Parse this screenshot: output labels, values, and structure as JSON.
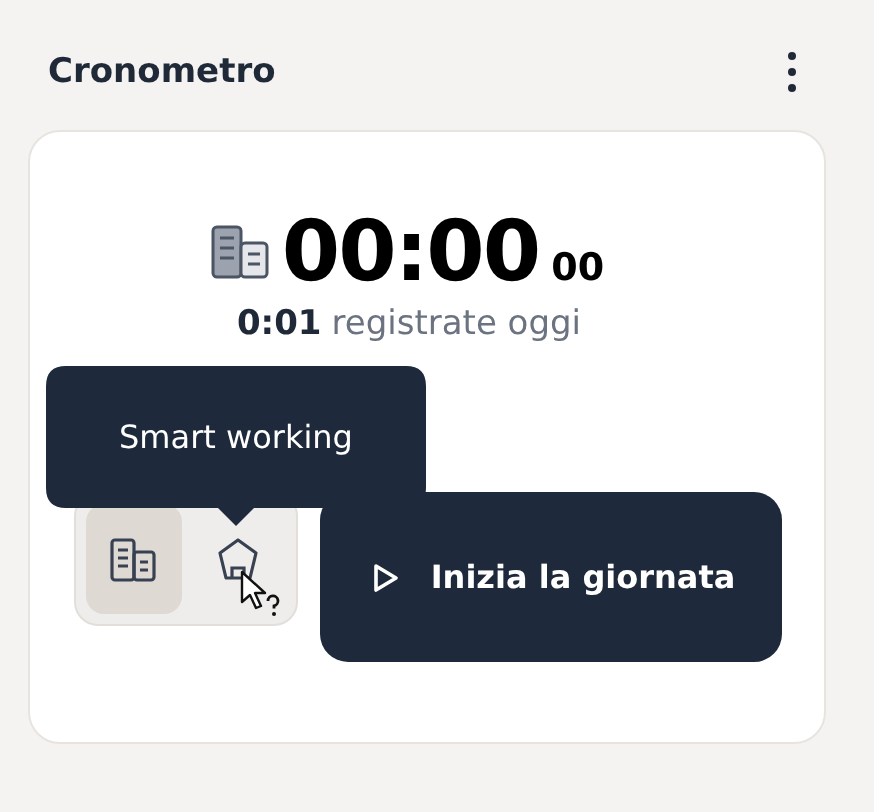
{
  "header": {
    "title": "Cronometro"
  },
  "timer": {
    "time": "00:00",
    "seconds": "00",
    "recorded": "0:01",
    "recorded_label": "registrate oggi"
  },
  "modes": [
    {
      "kind": "office",
      "selected": true
    },
    {
      "kind": "home",
      "selected": false
    }
  ],
  "tooltip": {
    "text": "Smart working"
  },
  "start_button": {
    "label": "Inizia la giornata"
  }
}
